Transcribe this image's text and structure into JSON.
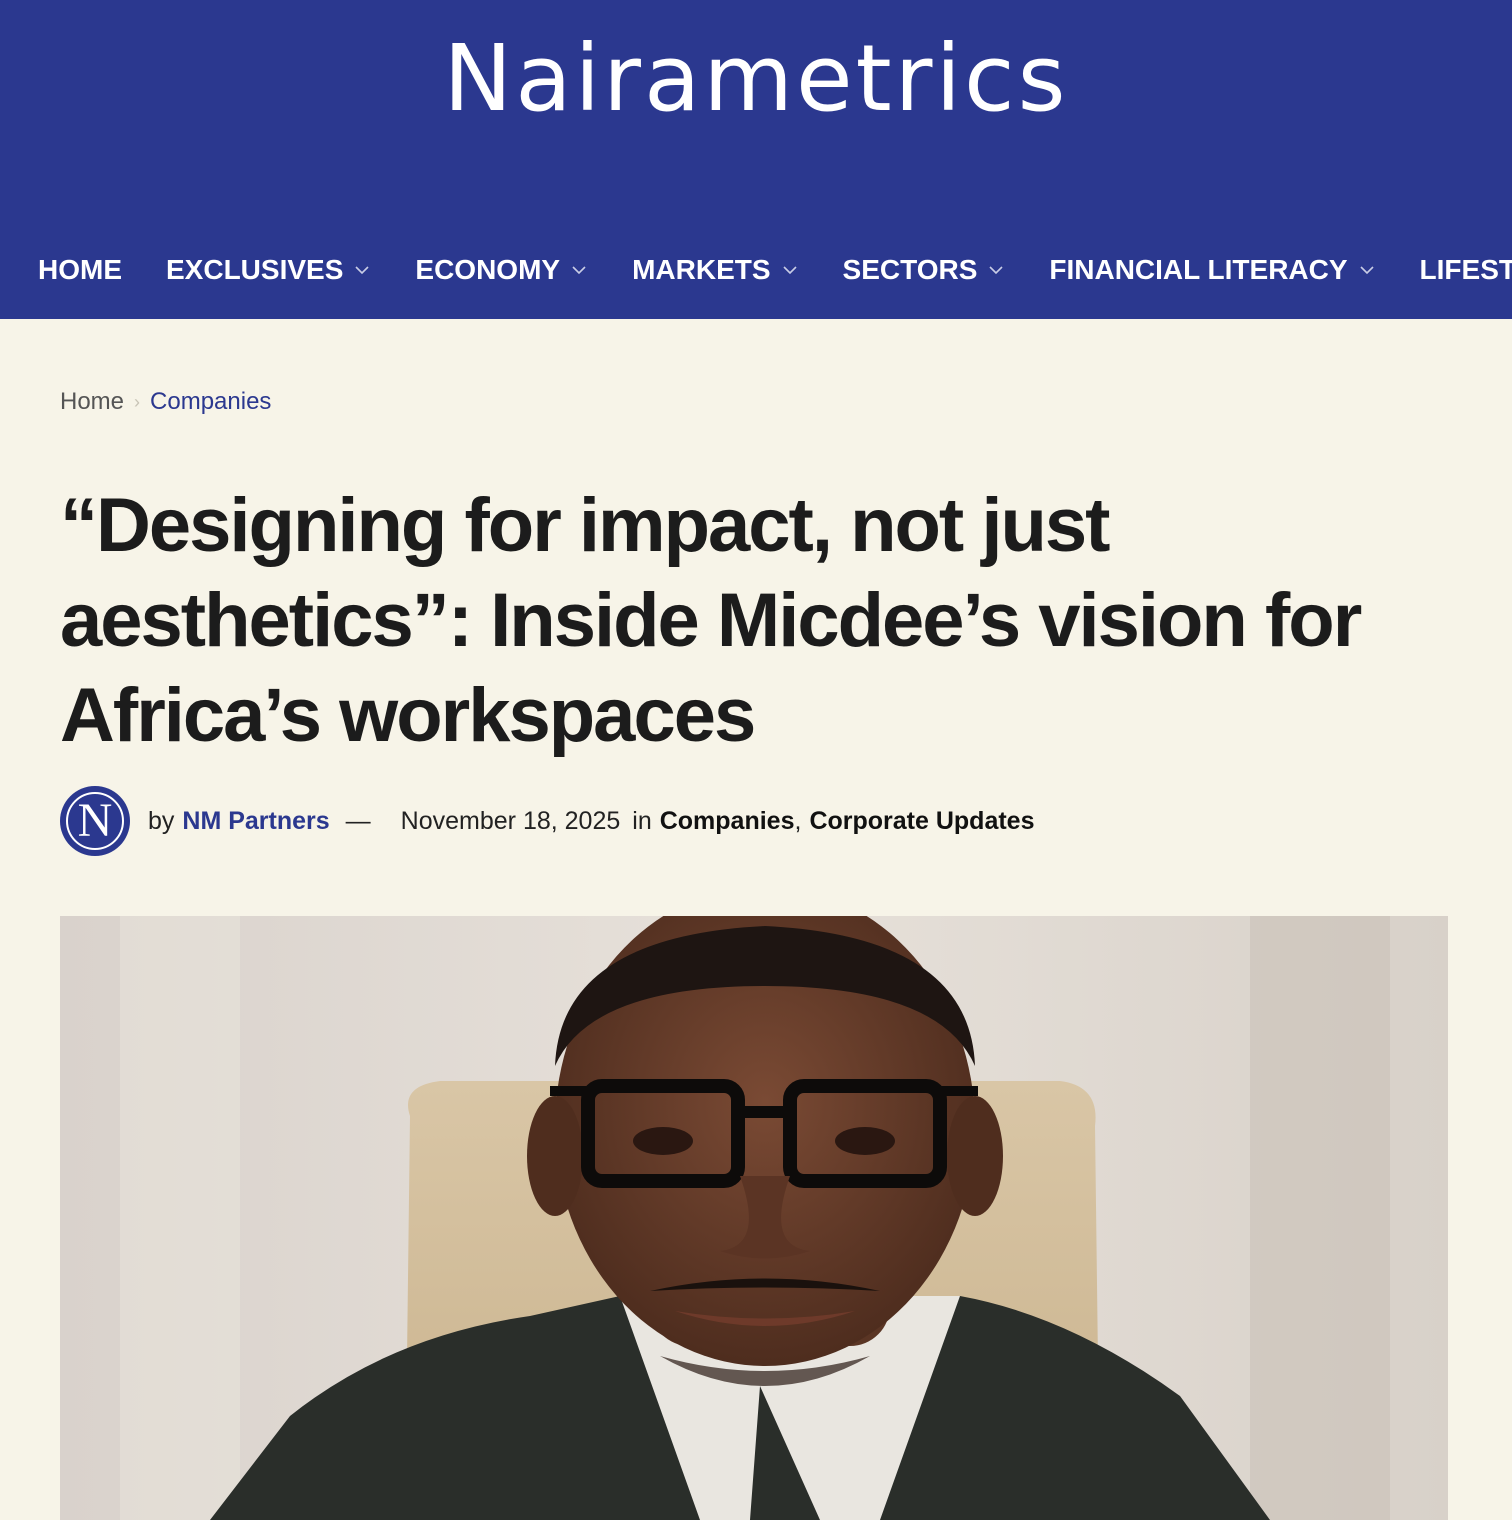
{
  "site": {
    "logo_text": "Nairametrics"
  },
  "nav": {
    "items": [
      {
        "label": "HOME",
        "has_dropdown": false
      },
      {
        "label": "EXCLUSIVES",
        "has_dropdown": true
      },
      {
        "label": "ECONOMY",
        "has_dropdown": true
      },
      {
        "label": "MARKETS",
        "has_dropdown": true
      },
      {
        "label": "SECTORS",
        "has_dropdown": true
      },
      {
        "label": "FINANCIAL LITERACY",
        "has_dropdown": true
      },
      {
        "label": "LIFESTYLE",
        "has_dropdown": true
      }
    ]
  },
  "breadcrumb": {
    "home": "Home",
    "separator": "›",
    "current": "Companies"
  },
  "article": {
    "title": "“Designing for impact, not just aesthetics”: Inside Micdee’s vision for Africa’s workspaces",
    "avatar_letter": "N",
    "by_label": "by",
    "author": "NM Partners",
    "dash": "—",
    "date": "November 18, 2025",
    "in_label": "in",
    "categories": [
      "Companies",
      "Corporate Updates"
    ],
    "hero_image": "portrait of a man with glasses in a dark suit, seated in a beige chair"
  },
  "colors": {
    "brand": "#2b388f",
    "page_bg": "#f7f4e8",
    "title": "#1c1c1c"
  }
}
